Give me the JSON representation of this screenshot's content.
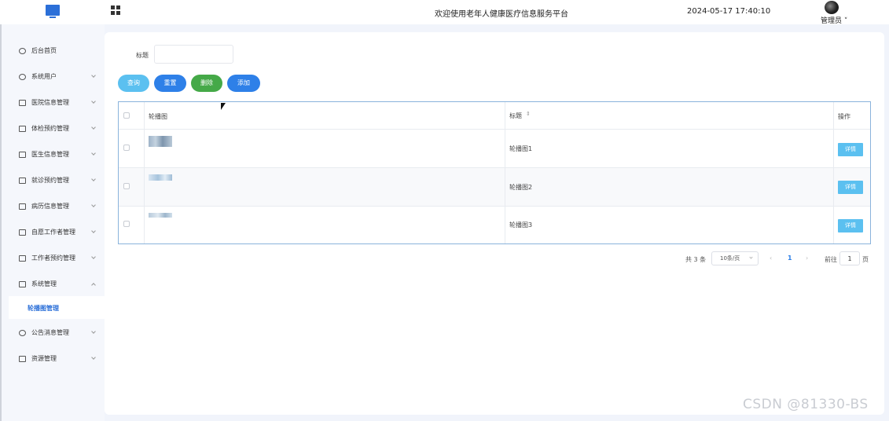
{
  "header": {
    "logo_icon": "monitor-icon",
    "menu_icon": "grid-icon",
    "site_title": "欢迎使用老年人健康医疗信息服务平台",
    "datetime": "2024-05-17 17:40:10",
    "user_name": "管理员",
    "user_dropdown_icon": "chevron-down-icon"
  },
  "sidebar": {
    "items": [
      {
        "label": "后台首页",
        "icon": "clock-icon"
      },
      {
        "label": "系统用户",
        "icon": "user-icon"
      },
      {
        "label": "医院信息管理",
        "icon": "window-icon"
      },
      {
        "label": "体检预约管理",
        "icon": "window-icon"
      },
      {
        "label": "医生信息管理",
        "icon": "window-icon"
      },
      {
        "label": "就诊预约管理",
        "icon": "window-icon"
      },
      {
        "label": "病历信息管理",
        "icon": "window-icon"
      },
      {
        "label": "自愿工作者管理",
        "icon": "window-icon"
      },
      {
        "label": "工作者预约管理",
        "icon": "window-icon"
      },
      {
        "label": "系统管理",
        "icon": "folder-icon"
      },
      {
        "label": "公告消息管理",
        "icon": "sparkle-icon"
      },
      {
        "label": "资源管理",
        "icon": "box-icon"
      }
    ],
    "active_sub_item": "轮播图管理"
  },
  "search": {
    "label": "标题",
    "value": "",
    "placeholder": ""
  },
  "toolbar": {
    "query": "查询",
    "reset": "重置",
    "delete": "删除",
    "add": "添加"
  },
  "table": {
    "columns": {
      "image": "轮播图",
      "title": "标题",
      "actions": "操作"
    },
    "sort_icon": "sort-icon",
    "rows": [
      {
        "title": "轮播图1",
        "action": "详情"
      },
      {
        "title": "轮播图2",
        "action": "详情"
      },
      {
        "title": "轮播图3",
        "action": "详情"
      }
    ]
  },
  "pagination": {
    "total": "共 3 条",
    "page_size": "10条/页",
    "prev": "‹",
    "current_page": "1",
    "next": "›",
    "goto_label": "前往",
    "goto_value": "1",
    "goto_unit": "页"
  },
  "watermark": "CSDN @81330-BS",
  "colors": {
    "primary": "#2e80e8",
    "info": "#5bc0f0",
    "success": "#45a948",
    "sidebar_bg": "#f5f7fc"
  }
}
